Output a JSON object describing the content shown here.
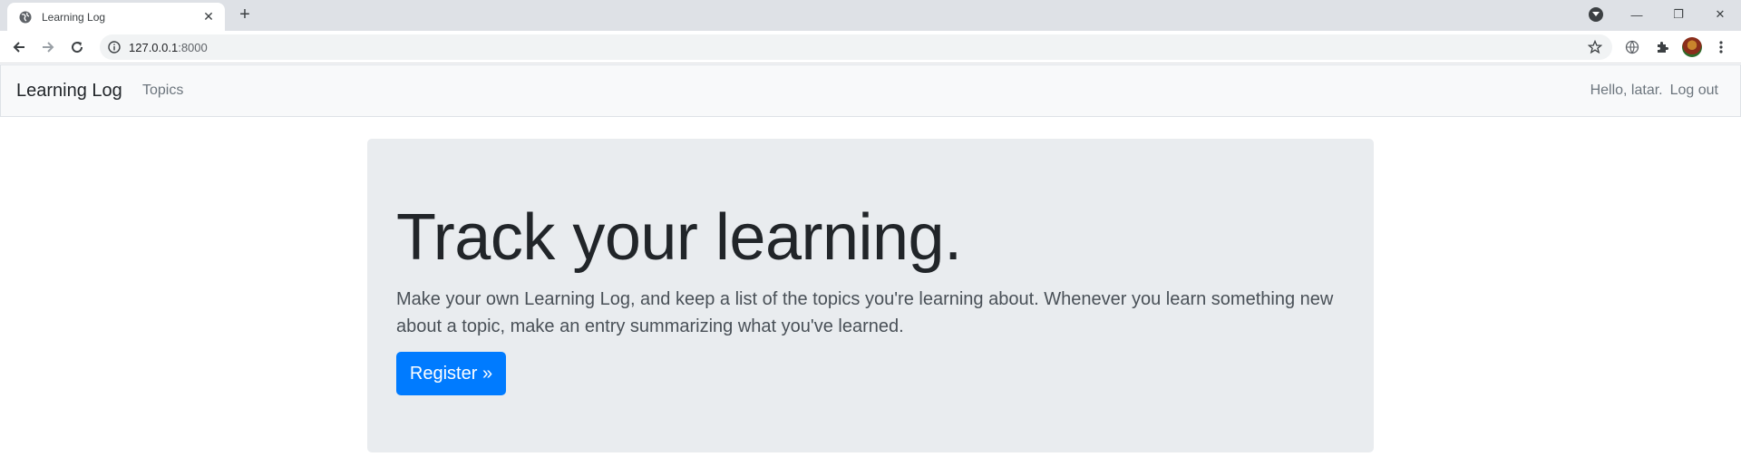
{
  "browser": {
    "tab": {
      "title": "Learning Log",
      "close_glyph": "✕",
      "favicon": "globe-icon"
    },
    "new_tab_glyph": "+",
    "url": {
      "host": "127.0.0.1",
      "port": ":8000"
    },
    "window_controls": {
      "minimize": "—",
      "restore": "❐",
      "close": "✕"
    }
  },
  "navbar": {
    "brand": "Learning Log",
    "topics": "Topics",
    "greeting": "Hello, latar.",
    "logout": "Log out"
  },
  "jumbotron": {
    "title": "Track your learning.",
    "lead": "Make your own Learning Log, and keep a list of the topics you're learning about. Whenever you learn something new about a topic, make an entry summarizing what you've learned.",
    "register": "Register »"
  },
  "colors": {
    "primary": "#007bff",
    "jumbotron_bg": "#e9ecef",
    "navbar_bg": "#f8f9fa",
    "tabstrip_bg": "#dee1e6"
  }
}
